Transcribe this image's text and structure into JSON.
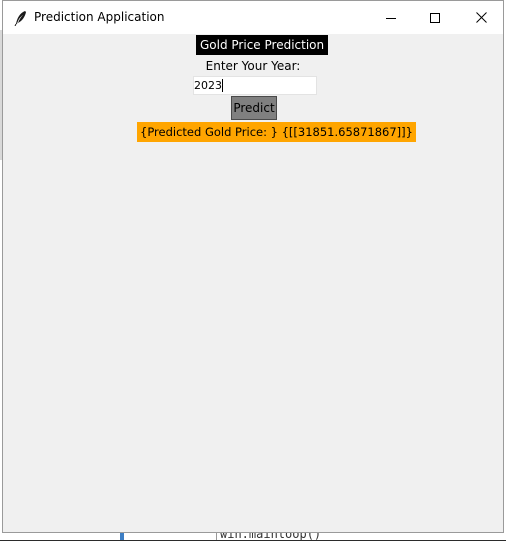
{
  "window": {
    "title": "Prediction Application"
  },
  "app": {
    "heading": "Gold Price Prediction",
    "year_label": "Enter Your Year:",
    "year_value": "2023",
    "predict_label": "Predict",
    "result_text": "{Predicted Gold Price: } {[[31851.65871867]]}"
  },
  "background": {
    "code_text": "win.mainloop()"
  },
  "colors": {
    "heading_bg": "#000000",
    "heading_fg": "#ffffff",
    "button_bg": "#808080",
    "result_bg": "#ffa500",
    "window_bg": "#f0f0f0"
  }
}
